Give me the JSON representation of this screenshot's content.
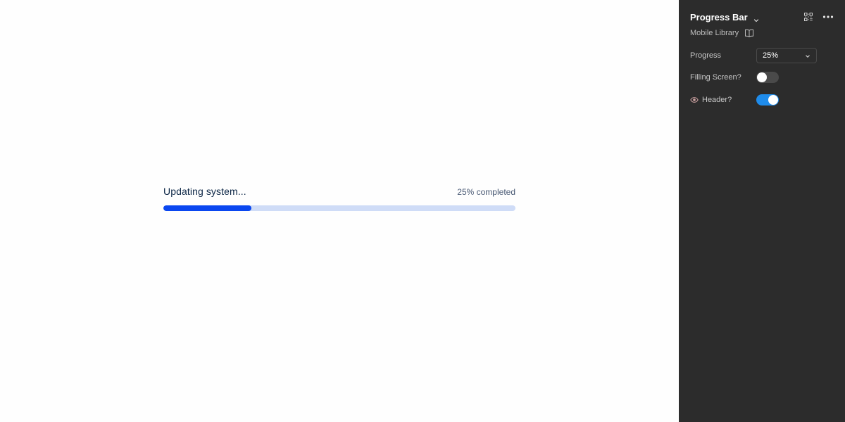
{
  "preview": {
    "title": "Updating system...",
    "status": "25% completed",
    "progress_fraction": 0.25,
    "colors": {
      "fill": "#0a47f0",
      "track": "#cfdcf7"
    }
  },
  "panel": {
    "component_name": "Progress Bar",
    "library_label": "Mobile Library",
    "icons": {
      "name_menu": "chevron-down-icon",
      "grid": "grid-icon",
      "more": "more-horizontal-icon",
      "library": "book-icon",
      "visibility": "eye-icon"
    },
    "properties": {
      "progress": {
        "label": "Progress",
        "value": "25%"
      },
      "filling_screen": {
        "label": "Filling Screen?",
        "checked": false
      },
      "header": {
        "label": "Header?",
        "checked": true
      }
    },
    "colors": {
      "background": "#2c2c2c",
      "toggle_on": "#1f8ceb",
      "toggle_off": "#4a4a4a"
    }
  }
}
